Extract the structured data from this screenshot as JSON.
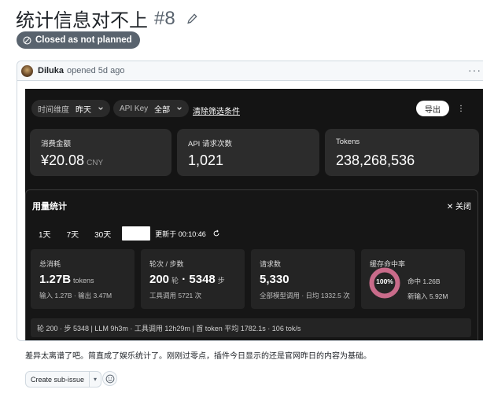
{
  "issue": {
    "title": "统计信息对不上",
    "number": "#8",
    "state_label": "Closed as not planned"
  },
  "comment": {
    "author": "Diluka",
    "action": "opened",
    "time": "5d ago",
    "more": "···"
  },
  "screenshot": {
    "filters": {
      "time_label": "时间维度",
      "time_value": "昨天",
      "api_label": "API Key",
      "api_value": "全部",
      "clear": "清除筛选条件"
    },
    "export_label": "导出",
    "menu_dots": "⋮",
    "stats": [
      {
        "label": "消费金额",
        "value": "¥20.08",
        "unit": "CNY"
      },
      {
        "label": "API 请求次数",
        "value": "1,021",
        "unit": ""
      },
      {
        "label": "Tokens",
        "value": "238,268,536",
        "unit": ""
      }
    ],
    "usage": {
      "title": "用量统计",
      "close": "✕ 关闭",
      "tabs": [
        "1天",
        "7天",
        "30天"
      ],
      "updated": "更新于 00:10:46",
      "metrics": {
        "total": {
          "label": "总消耗",
          "value": "1.27B",
          "unit": "tokens",
          "sub": "输入 1.27B · 输出 3.47M"
        },
        "turns": {
          "label": "轮次 / 步数",
          "value1": "200",
          "unit1": "轮",
          "sep": "·",
          "value2": "5348",
          "unit2": "步",
          "sub": "工具调用 5721 次"
        },
        "requests": {
          "label": "请求数",
          "value": "5,330",
          "sub": "全部模型调用 · 日均 1332.5 次"
        },
        "cache": {
          "label": "缓存命中率",
          "percent": "100%",
          "fraction": 1.0,
          "hit": "命中 1.26B",
          "new": "新输入 5.92M"
        }
      },
      "summary": "轮 200 · 步 5348 | LLM 9h3m · 工具调用 12h29m | 首 token 平均 1782.1s · 106 tok/s"
    }
  },
  "caption": "差异太离谱了吧。简直成了娱乐统计了。刚刚过零点，插件今日显示的还是官网昨日的内容为基础。",
  "actions": {
    "create_sub_issue": "Create sub-issue",
    "caret": "▾"
  },
  "colors": {
    "closed_badge": "#59636e",
    "donut_ring": "#c96b8a",
    "panel_bg": "#141414"
  }
}
